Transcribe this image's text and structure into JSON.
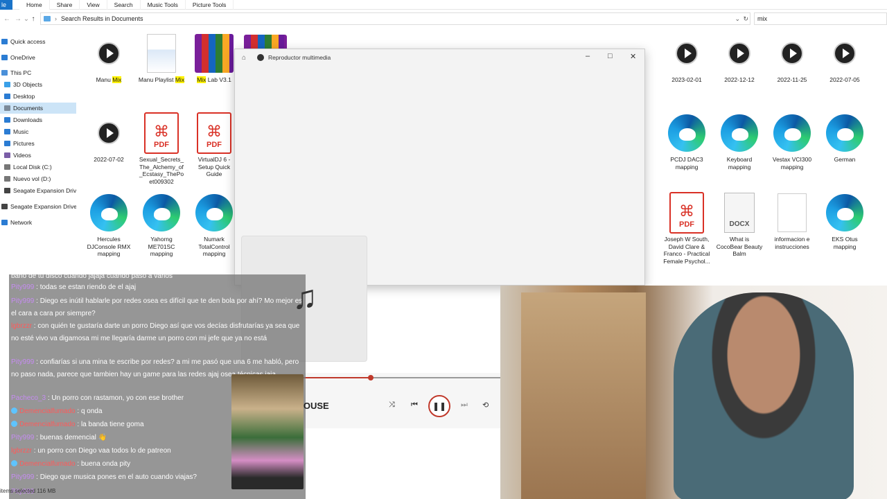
{
  "ribbon": {
    "file_label": "le",
    "tabs": [
      "Home",
      "Share",
      "View",
      "Search",
      "Music Tools",
      "Picture Tools"
    ]
  },
  "address": {
    "path": "Search Results in Documents",
    "search_value": "mix"
  },
  "sidebar": {
    "items": [
      {
        "label": "Quick access",
        "icon": "star-icon",
        "color": "#2b7cd3"
      },
      {
        "label": "OneDrive",
        "icon": "cloud-icon",
        "color": "#2b7cd3"
      },
      {
        "label": "This PC",
        "icon": "computer-icon",
        "color": "#4a90d9"
      },
      {
        "label": "3D Objects",
        "icon": "cube-icon",
        "color": "#3aa0e8"
      },
      {
        "label": "Desktop",
        "icon": "desktop-icon",
        "color": "#2b7cd3"
      },
      {
        "label": "Documents",
        "icon": "documents-icon",
        "color": "#7b8a99"
      },
      {
        "label": "Downloads",
        "icon": "download-icon",
        "color": "#2b7cd3"
      },
      {
        "label": "Music",
        "icon": "music-icon",
        "color": "#2b7cd3"
      },
      {
        "label": "Pictures",
        "icon": "pictures-icon",
        "color": "#2b7cd3"
      },
      {
        "label": "Videos",
        "icon": "videos-icon",
        "color": "#7b5ea7"
      },
      {
        "label": "Local Disk (C:)",
        "icon": "disk-icon",
        "color": "#777"
      },
      {
        "label": "Nuevo vol (D:)",
        "icon": "disk-icon",
        "color": "#777"
      },
      {
        "label": "Seagate Expansion Drive",
        "icon": "drive-icon",
        "color": "#444"
      },
      {
        "label": "Seagate Expansion Drive (",
        "icon": "drive-icon",
        "color": "#444"
      },
      {
        "label": "Network",
        "icon": "network-icon",
        "color": "#2b7cd3"
      }
    ]
  },
  "files": {
    "manu_mix": {
      "pre": "Manu ",
      "hl": "Mix",
      "post": ""
    },
    "manu_playlist": {
      "pre": "Manu Playlist ",
      "hl": "Mix",
      "post": ""
    },
    "mix_lab": {
      "pre": "",
      "hl": "Mix",
      "post": " Lab V3.1"
    },
    "d_20230201": "2023-02-01",
    "d_20221212": "2022-12-12",
    "d_20221125": "2022-11-25",
    "d_20220705": "2022-07-05",
    "d_20220702": "2022-07-02",
    "pdf_sexual": "Sexual_Secrets_The_Alchemy_of_Ecstasy_ThePoet009302",
    "pdf_virtualdj": "VirtualDJ 6 - Setup Quick Guide",
    "pcdj": "PCDJ DAC3 mapping",
    "keyboard": "Keyboard mapping",
    "vestax": "Vestax VCI300 mapping",
    "german": "German",
    "hercules": "Hercules DJConsole RMX mapping",
    "yahorng": "Yahorng ME701SC mapping",
    "numark": "Numark TotalControl mapping",
    "pdf_joseph": "Joseph W South, David Clare & Franco - Practical Female Psychol...",
    "docx_what": "What is CocoBear Beauty Balm",
    "informacion": "informacion e instrucciones",
    "eks": "EKS Otus mapping",
    "pdf_text": "PDF",
    "docx_text": "DOCX"
  },
  "player": {
    "title": "Reproductor multimedia",
    "track_suffix": "MOUSE",
    "progress": 0.38
  },
  "chat": {
    "messages": [
      {
        "user": "",
        "text": "bano de tu disco cuando jajaja cuando paso a varios",
        "style": ""
      },
      {
        "user": "Pity999",
        "text": ": todas se estan riendo de el ajaj",
        "style": ""
      },
      {
        "user": "Pity999",
        "text": ": Diego es inútil hablarle por redes osea es difícil que te den bola por ahí? Mo mejor es el cara a cara por siempre?",
        "style": ""
      },
      {
        "user": "lgbrzzr",
        "text": ": con quién te gustaría darte un porro Diego así que vos decías disfrutarías ya sea que no esté vivo va digamosa mi me llegaría darme un porro con mi jefe que ya no está",
        "style": "red"
      },
      {
        "user": "Pity999",
        "text": ": confiarías si una mina te escribe por redes? a mi me pasó que una 6 me habló, pero no paso nada, parece que tambien hay un game para las redes ajaj osea técnicas jaja",
        "style": ""
      },
      {
        "user": "Pacheco_3",
        "text": ": Un porro con rastamon, yo con ese brother",
        "style": ""
      },
      {
        "user": "Demencialfumado",
        "text": ": q onda",
        "style": "red",
        "badge": true
      },
      {
        "user": "Demencialfumado",
        "text": ": la banda tiene goma",
        "style": "red",
        "badge": true
      },
      {
        "user": "Pity999",
        "text": ": buenas demencial 👋",
        "style": ""
      },
      {
        "user": "lgbrzzr",
        "text": ": un porro con Diego vaa todos lo de patreon",
        "style": "red"
      },
      {
        "user": "Demencialfumado",
        "text": ": buena onda pity",
        "style": "red",
        "badge": true
      },
      {
        "user": "Pity999",
        "text": ": Diego que musica pones en el auto cuando viajas?",
        "style": ""
      },
      {
        "user": "Pity999",
        "text": "",
        "style": ""
      }
    ]
  },
  "status": {
    "text": "items   selected   116 MB"
  }
}
